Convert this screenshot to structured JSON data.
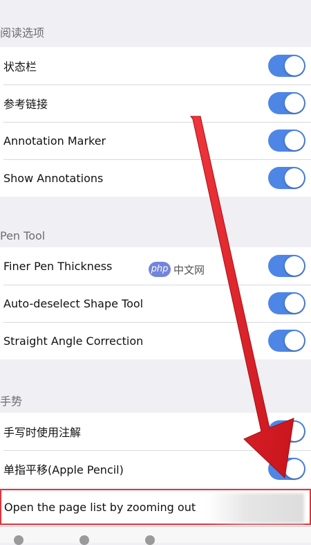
{
  "sections": {
    "reading": {
      "header": "阅读选项",
      "items": [
        {
          "label": "状态栏",
          "on": true
        },
        {
          "label": "参考链接",
          "on": true
        },
        {
          "label": "Annotation Marker",
          "on": true
        },
        {
          "label": "Show Annotations",
          "on": true
        }
      ]
    },
    "pen": {
      "header": "Pen Tool",
      "items": [
        {
          "label": "Finer Pen Thickness",
          "on": true
        },
        {
          "label": "Auto-deselect Shape Tool",
          "on": true
        },
        {
          "label": "Straight Angle Correction",
          "on": true
        }
      ]
    },
    "gesture": {
      "header": "手势",
      "items": [
        {
          "label": "手写时使用注解",
          "on": true
        },
        {
          "label": "单指平移(Apple Pencil)",
          "on": true
        }
      ]
    }
  },
  "highlighted": {
    "label": "Open the page list by zooming out"
  },
  "watermark": {
    "badge": "php",
    "text": "中文网"
  },
  "colors": {
    "toggle_on": "#4e86e6",
    "arrow": "#e2282f",
    "highlight_border": "#e2343a"
  },
  "icons": {
    "watermark": "php-logo-icon",
    "annotation": "red-arrow-icon"
  }
}
